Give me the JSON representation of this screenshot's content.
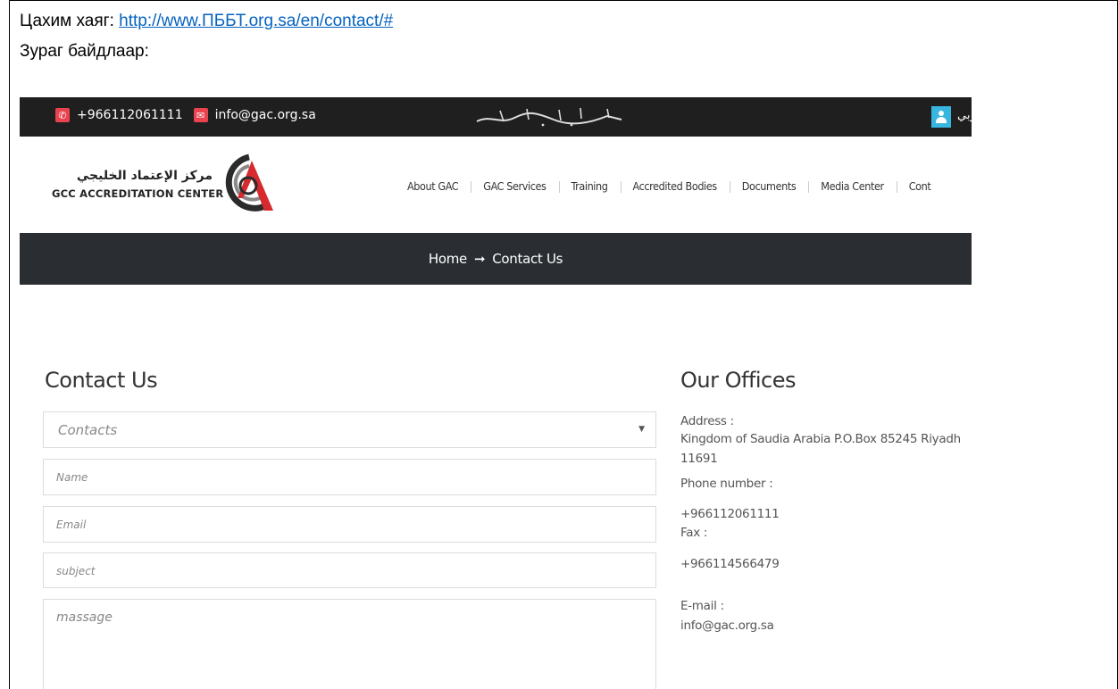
{
  "doc": {
    "link_label": "Цахим хаяг: ",
    "link_url_text": "http://www.ПББТ.org.sa/en/contact/#",
    "images_label": "Зураг байдлаар:"
  },
  "topbar": {
    "phone": "+966112061111",
    "email": "info@gac.org.sa",
    "basmala": "بسم الله الرحمن الرحيم",
    "language_link": "عربي"
  },
  "logo": {
    "arabic_name": "مركز الإعتماد الخليجي",
    "english_name": "GCC ACCREDITATION CENTER"
  },
  "nav": {
    "items": [
      {
        "label": "About GAC"
      },
      {
        "label": "GAC Services"
      },
      {
        "label": "Training"
      },
      {
        "label": "Accredited Bodies"
      },
      {
        "label": "Documents"
      },
      {
        "label": "Media Center"
      },
      {
        "label": "Cont"
      }
    ]
  },
  "breadcrumb": {
    "home": "Home",
    "arrow": "➞",
    "current": "Contact Us"
  },
  "contact_form": {
    "heading": "Contact Us",
    "select_value": "Contacts",
    "name_placeholder": "Name",
    "email_placeholder": "Email",
    "subject_placeholder": "subject",
    "message_placeholder": "massage"
  },
  "offices": {
    "heading": "Our Offices",
    "address_label": "Address :",
    "address_line1": "Kingdom of Saudia Arabia P.O.Box 85245 Riyadh",
    "address_line2": "11691",
    "phone_label": "Phone number :",
    "phone_value": "+966112061111",
    "fax_label": "Fax :",
    "fax_value": "+966114566479",
    "email_label": "E-mail :",
    "email_value": "info@gac.org.sa"
  },
  "colors": {
    "topbar_bg": "#1f1f1f",
    "breadcrumb_bg": "#2a2e33",
    "icon_red": "#e8434f",
    "user_icon_blue": "#38b6e0",
    "link_blue": "#0563c1"
  },
  "icons": [
    "phone-icon",
    "email-icon",
    "user-icon",
    "select-caret-icon"
  ]
}
